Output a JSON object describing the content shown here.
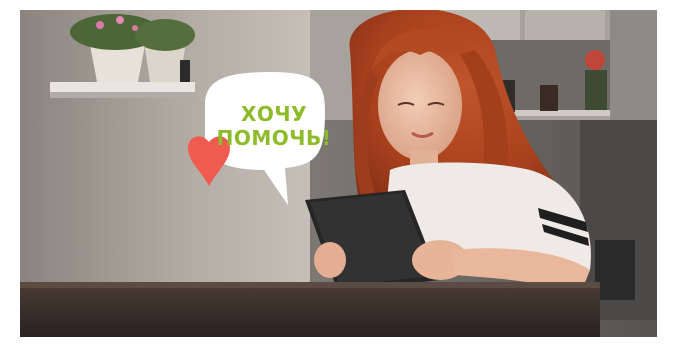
{
  "scene": {
    "description_icon": "photo-woman-with-tablet",
    "speech_bubble": {
      "line1": "ХОЧУ",
      "line2": "ПОМОЧЬ!",
      "text_color": "#8dbb2a",
      "bubble_color": "#ffffff",
      "heart_color": "#f05b4f"
    }
  }
}
